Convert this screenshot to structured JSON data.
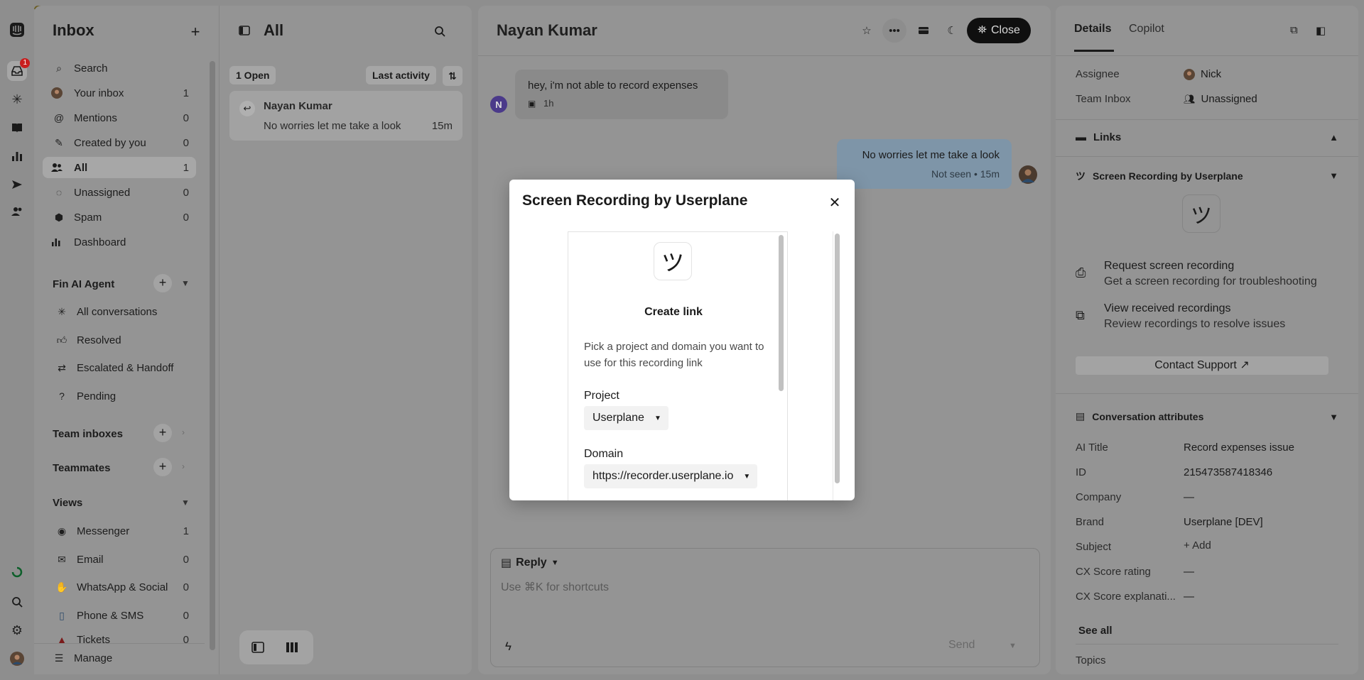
{
  "rail": {
    "inbox_badge": "1"
  },
  "sidebar": {
    "title": "Inbox",
    "search": "Search",
    "items": [
      {
        "label": "Your inbox",
        "count": "1"
      },
      {
        "label": "Mentions",
        "count": "0"
      },
      {
        "label": "Created by you",
        "count": "0"
      },
      {
        "label": "All",
        "count": "1"
      },
      {
        "label": "Unassigned",
        "count": "0"
      },
      {
        "label": "Spam",
        "count": "0"
      },
      {
        "label": "Dashboard",
        "count": ""
      }
    ],
    "fin_section": "Fin AI Agent",
    "fin_items": [
      "All conversations",
      "Resolved",
      "Escalated & Handoff",
      "Pending"
    ],
    "team_inboxes": "Team inboxes",
    "teammates": "Teammates",
    "views": "Views",
    "view_items": [
      {
        "label": "Messenger",
        "count": "1"
      },
      {
        "label": "Email",
        "count": "0"
      },
      {
        "label": "WhatsApp & Social",
        "count": "0"
      },
      {
        "label": "Phone & SMS",
        "count": "0"
      },
      {
        "label": "Tickets",
        "count": "0"
      }
    ],
    "manage": "Manage"
  },
  "list": {
    "title": "All",
    "open_count": "1 Open",
    "sort": "Last activity",
    "card": {
      "name": "Nayan Kumar",
      "preview": "No worries let me take a look",
      "time": "15m"
    }
  },
  "conversation": {
    "title": "Nayan Kumar",
    "close_label": "Close",
    "avatar_initial": "N",
    "msg_in": {
      "text": "hey, i'm not able to record expenses",
      "time": "1h"
    },
    "msg_out": {
      "text": "No worries let me take a look",
      "status": "Not seen • 15m"
    },
    "reply_label": "Reply",
    "composer_placeholder": "Use ⌘K for shortcuts",
    "send_label": "Send"
  },
  "details": {
    "tabs": [
      "Details",
      "Copilot"
    ],
    "assignee_label": "Assignee",
    "assignee_value": "Nick",
    "team_inbox_label": "Team Inbox",
    "team_inbox_value": "Unassigned",
    "links_label": "Links",
    "recording_section": "Screen Recording by Userplane",
    "request_title": "Request screen recording",
    "request_desc": "Get a screen recording for troubleshooting",
    "view_title": "View received recordings",
    "view_desc": "Review recordings to resolve issues",
    "contact_support": "Contact Support ↗",
    "attributes_section": "Conversation attributes",
    "attributes": [
      {
        "label": "AI Title",
        "value": "Record expenses issue"
      },
      {
        "label": "ID",
        "value": "215473587418346"
      },
      {
        "label": "Company",
        "value": "—"
      },
      {
        "label": "Brand",
        "value": "Userplane [DEV]"
      },
      {
        "label": "Subject",
        "value": "+ Add"
      },
      {
        "label": "CX Score rating",
        "value": "—"
      },
      {
        "label": "CX Score explanati...",
        "value": "—"
      }
    ],
    "see_all": "See all",
    "topics": "Topics"
  },
  "modal": {
    "title": "Screen Recording by Userplane",
    "logo_glyph": "ツ",
    "heading": "Create link",
    "description": "Pick a project and domain you want to use for this recording link",
    "project_label": "Project",
    "project_value": "Userplane",
    "domain_label": "Domain",
    "domain_value": "https://recorder.userplane.io"
  }
}
